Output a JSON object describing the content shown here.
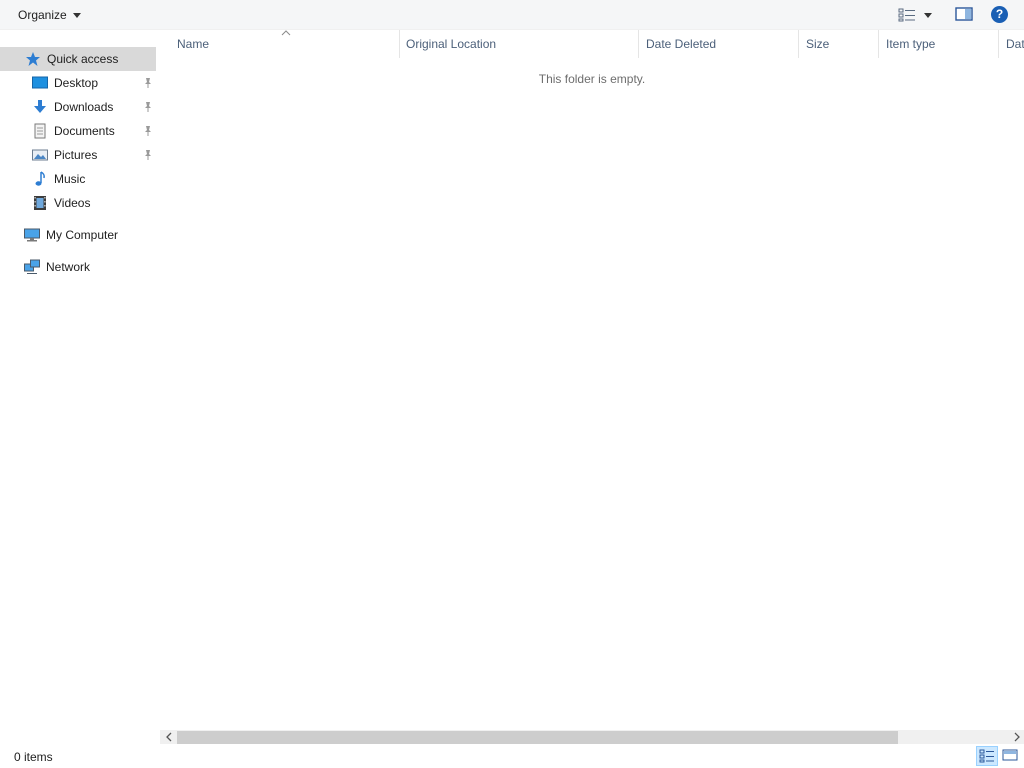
{
  "toolbar": {
    "organize_label": "Organize",
    "icons": [
      "view-options-icon",
      "preview-pane-icon",
      "help-icon"
    ],
    "help_glyph": "?"
  },
  "nav": {
    "items": [
      {
        "label": "Quick access",
        "icon": "star-icon",
        "selected": true
      },
      {
        "label": "Desktop",
        "icon": "desktop-icon",
        "pinned": true
      },
      {
        "label": "Downloads",
        "icon": "downloads-icon",
        "pinned": true
      },
      {
        "label": "Documents",
        "icon": "documents-icon",
        "pinned": true
      },
      {
        "label": "Pictures",
        "icon": "pictures-icon",
        "pinned": true
      },
      {
        "label": "Music",
        "icon": "music-icon"
      },
      {
        "label": "Videos",
        "icon": "videos-icon"
      },
      {
        "label": "My Computer",
        "icon": "computer-icon"
      },
      {
        "label": "Network",
        "icon": "network-icon"
      }
    ]
  },
  "columns": [
    {
      "label": "Name"
    },
    {
      "label": "Original Location"
    },
    {
      "label": "Date Deleted"
    },
    {
      "label": "Size"
    },
    {
      "label": "Item type"
    },
    {
      "label": "Dat"
    }
  ],
  "content": {
    "empty_message": "This folder is empty."
  },
  "status": {
    "item_count": "0 items"
  },
  "colors": {
    "selected_nav": "#d9d9d9",
    "header_text": "#4c607a",
    "accent": "#1a5fb4"
  }
}
